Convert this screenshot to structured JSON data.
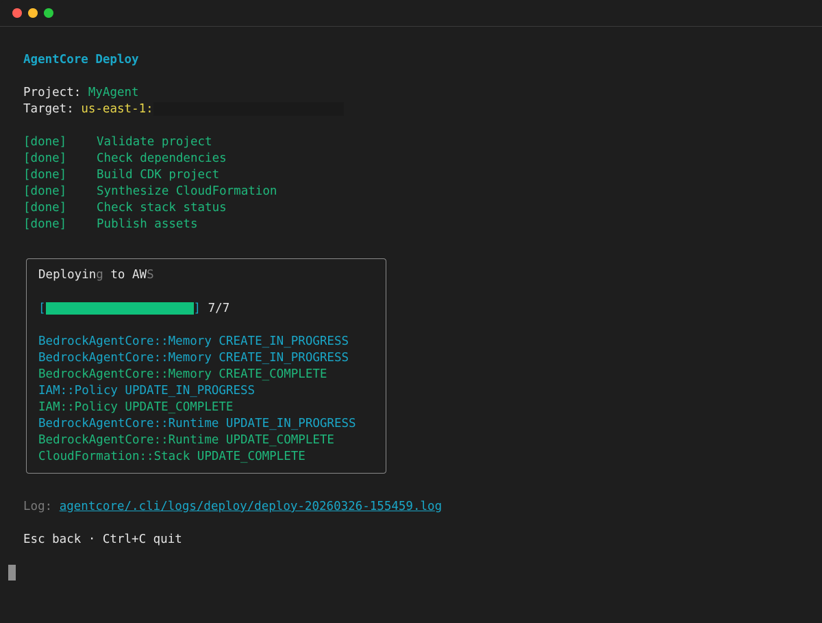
{
  "colors": {
    "cyan": "#1aa7c8",
    "green": "#1fb87c",
    "yellow": "#e8d64a",
    "white": "#e6e6e6",
    "dim": "#7a7a7a",
    "dot_red": "#ff5f57",
    "dot_yellow": "#febc2e",
    "dot_green": "#28c840"
  },
  "header": {
    "title": "AgentCore Deploy",
    "project_label": "Project:",
    "project_value": "MyAgent",
    "target_label": "Target:",
    "target_value": "us-east-1:"
  },
  "steps": [
    {
      "status": "[done]",
      "label": "Validate project"
    },
    {
      "status": "[done]",
      "label": "Check dependencies"
    },
    {
      "status": "[done]",
      "label": "Build CDK project"
    },
    {
      "status": "[done]",
      "label": "Synthesize CloudFormation"
    },
    {
      "status": "[done]",
      "label": "Check stack status"
    },
    {
      "status": "[done]",
      "label": "Publish assets"
    }
  ],
  "panel": {
    "title_a": "Deployin",
    "title_b": "g",
    "title_c": " to AW",
    "title_d": "S",
    "progress_open": "[",
    "progress_close": "]",
    "progress_text": "7/7",
    "progress_fraction": 1.0,
    "events": [
      {
        "text": "BedrockAgentCore::Memory CREATE_IN_PROGRESS",
        "state": "progress"
      },
      {
        "text": "BedrockAgentCore::Memory CREATE_IN_PROGRESS",
        "state": "progress"
      },
      {
        "text": "BedrockAgentCore::Memory CREATE_COMPLETE",
        "state": "complete"
      },
      {
        "text": "IAM::Policy UPDATE_IN_PROGRESS",
        "state": "progress"
      },
      {
        "text": "IAM::Policy UPDATE_COMPLETE",
        "state": "complete"
      },
      {
        "text": "BedrockAgentCore::Runtime UPDATE_IN_PROGRESS",
        "state": "progress"
      },
      {
        "text": "BedrockAgentCore::Runtime UPDATE_COMPLETE",
        "state": "complete"
      },
      {
        "text": "CloudFormation::Stack UPDATE_COMPLETE",
        "state": "complete"
      }
    ]
  },
  "log": {
    "label": "Log:",
    "path": "agentcore/.cli/logs/deploy/deploy-20260326-155459.log"
  },
  "footer": {
    "hint": "Esc back · Ctrl+C quit"
  }
}
